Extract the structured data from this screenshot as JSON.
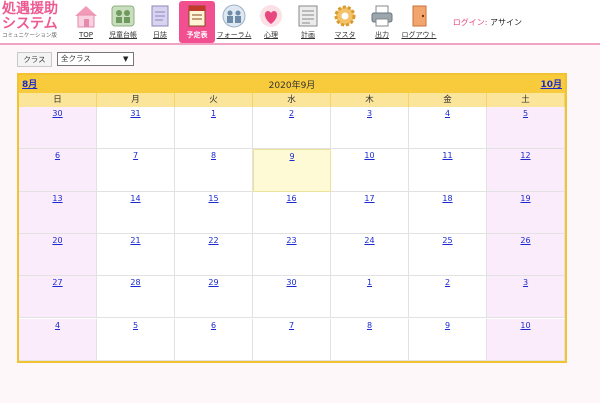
{
  "app": {
    "logo_line1": "処遇援助",
    "logo_line2": "システム",
    "logo_sub": "コミュニケーション版"
  },
  "nav": [
    {
      "label": "TOP",
      "icon": "house-icon"
    },
    {
      "label": "児童台帳",
      "icon": "children-icon"
    },
    {
      "label": "日誌",
      "icon": "diary-icon"
    },
    {
      "label": "予定表",
      "icon": "schedule-icon",
      "active": true
    },
    {
      "label": "フォーラム",
      "icon": "forum-icon"
    },
    {
      "label": "心理",
      "icon": "heart-icon"
    },
    {
      "label": "計画",
      "icon": "plan-icon"
    },
    {
      "label": "マスタ",
      "icon": "gear-icon"
    },
    {
      "label": "出力",
      "icon": "printer-icon"
    },
    {
      "label": "ログアウト",
      "icon": "logout-door-icon"
    }
  ],
  "login": {
    "key": "ログイン:",
    "user": "アサイン"
  },
  "class_filter": {
    "label": "クラス",
    "selected": "全クラス"
  },
  "calendar": {
    "title": "2020年9月",
    "prev": "8月",
    "next": "10月",
    "weekdays": [
      "日",
      "月",
      "火",
      "水",
      "木",
      "金",
      "土"
    ],
    "weeks": [
      [
        "30",
        "31",
        "1",
        "2",
        "3",
        "4",
        "5"
      ],
      [
        "6",
        "7",
        "8",
        "9",
        "10",
        "11",
        "12"
      ],
      [
        "13",
        "14",
        "15",
        "16",
        "17",
        "18",
        "19"
      ],
      [
        "20",
        "21",
        "22",
        "23",
        "24",
        "25",
        "26"
      ],
      [
        "27",
        "28",
        "29",
        "30",
        "1",
        "2",
        "3"
      ],
      [
        "4",
        "5",
        "6",
        "7",
        "8",
        "9",
        "10"
      ]
    ],
    "highlight_day": "9"
  },
  "colors": {
    "accent_pink": "#f14f8f",
    "calendar_header": "#f7cb3c",
    "weekday_header": "#fbe59a",
    "weekend_bg": "#fbecfb",
    "today_bg": "#fdfad5",
    "link": "#1b2ad0"
  }
}
